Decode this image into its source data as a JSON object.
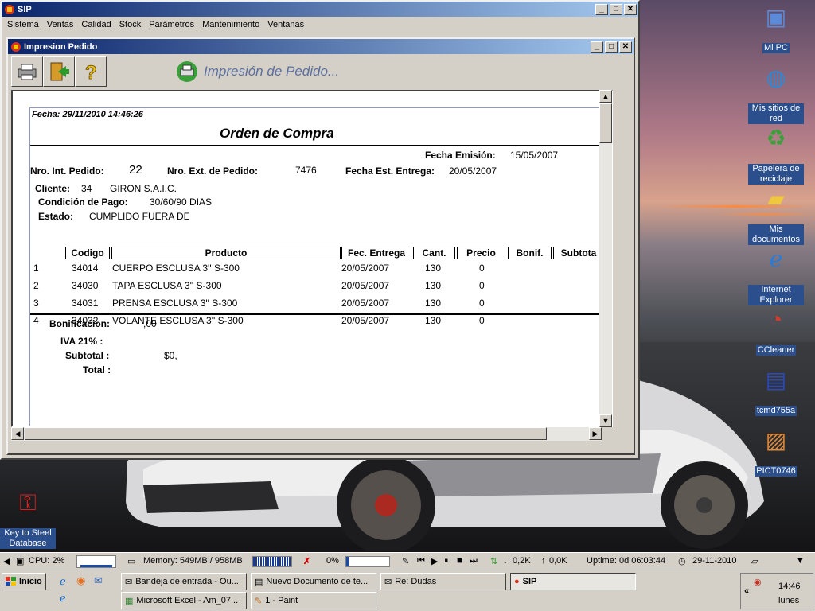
{
  "window": {
    "title": "SIP",
    "menu": [
      "Sistema",
      "Ventas",
      "Calidad",
      "Stock",
      "Parámetros",
      "Mantenimiento",
      "Ventanas"
    ]
  },
  "child": {
    "title": "Impresion Pedido",
    "header_title": "Impresión de Pedido...",
    "tools": [
      "printer-icon",
      "exit-door-icon",
      "help-icon"
    ]
  },
  "report": {
    "fecha": "Fecha: 29/11/2010 14:46:26",
    "title": "Orden de Compra",
    "fecha_emision_label": "Fecha Emisión:",
    "fecha_emision": "15/05/2007",
    "nro_int_label": "Nro. Int. Pedido:",
    "nro_int": "22",
    "nro_ext_label": "Nro. Ext. de Pedido:",
    "nro_ext": "7476",
    "fecha_entrega_label": "Fecha Est. Entrega:",
    "fecha_entrega": "20/05/2007",
    "cliente_label": "Cliente:",
    "cliente_id": "34",
    "cliente_nombre": "GIRON S.A.I.C.",
    "condicion_label": "Condición de Pago:",
    "condicion": "30/60/90 DIAS",
    "estado_label": "Estado:",
    "estado": "CUMPLIDO FUERA DE",
    "columns": [
      "Codigo",
      "Producto",
      "Fec. Entrega",
      "Cant.",
      "Precio",
      "Bonif.",
      "Subtota"
    ],
    "rows": [
      {
        "n": "1",
        "codigo": "34014",
        "producto": "CUERPO ESCLUSA 3'' S-300",
        "entrega": "20/05/2007",
        "cant": "130",
        "precio": "0"
      },
      {
        "n": "2",
        "codigo": "34030",
        "producto": "TAPA ESCLUSA 3'' S-300",
        "entrega": "20/05/2007",
        "cant": "130",
        "precio": "0"
      },
      {
        "n": "3",
        "codigo": "34031",
        "producto": "PRENSA ESCLUSA 3'' S-300",
        "entrega": "20/05/2007",
        "cant": "130",
        "precio": "0"
      },
      {
        "n": "4",
        "codigo": "34032",
        "producto": "VOLANTE ESCLUSA 3'' S-300",
        "entrega": "20/05/2007",
        "cant": "130",
        "precio": "0"
      }
    ],
    "bonificacion_label": "Bonificacion:",
    "bonificacion": ",00",
    "iva_label": "IVA 21% :",
    "subtotal_label": "Subtotal :",
    "subtotal": "$0,",
    "total_label": "Total :"
  },
  "desktop_icons": [
    {
      "label": "Mi PC",
      "icon": "my-computer-icon"
    },
    {
      "label": "Mis sitios de red",
      "icon": "network-icon"
    },
    {
      "label": "Papelera de reciclaje",
      "icon": "recycle-bin-icon"
    },
    {
      "label": "Mis documentos",
      "icon": "my-documents-icon"
    },
    {
      "label": "Internet Explorer",
      "icon": "internet-explorer-icon"
    },
    {
      "label": "CCleaner",
      "icon": "ccleaner-icon"
    },
    {
      "label": "tcmd755a",
      "icon": "floppy-icon"
    },
    {
      "label": "PICT0746",
      "icon": "image-file-icon"
    },
    {
      "label": "Key to Steel Database",
      "icon": "steel-key-icon"
    }
  ],
  "status": {
    "cpu": "CPU: 2%",
    "memory": "Memory: 549MB / 958MB",
    "net_pct": "0%",
    "down": "0,2K",
    "up": "0,0K",
    "uptime": "Uptime: 0d 06:03:44",
    "date": "29-11-2010"
  },
  "taskbar": {
    "start": "Inicio",
    "buttons": [
      "Bandeja de entrada - Ou...",
      "Nuevo Documento de te...",
      "Re: Dudas",
      "SIP",
      "Microsoft Excel - Am_07...",
      "1 - Paint"
    ],
    "clock": "14:46",
    "day": "lunes"
  },
  "colors": {
    "titlebar_start": "#0a246a",
    "titlebar_end": "#a6caf0",
    "header_text": "#5b6f9e",
    "desktop_label_bg": "#2a4f8c"
  }
}
